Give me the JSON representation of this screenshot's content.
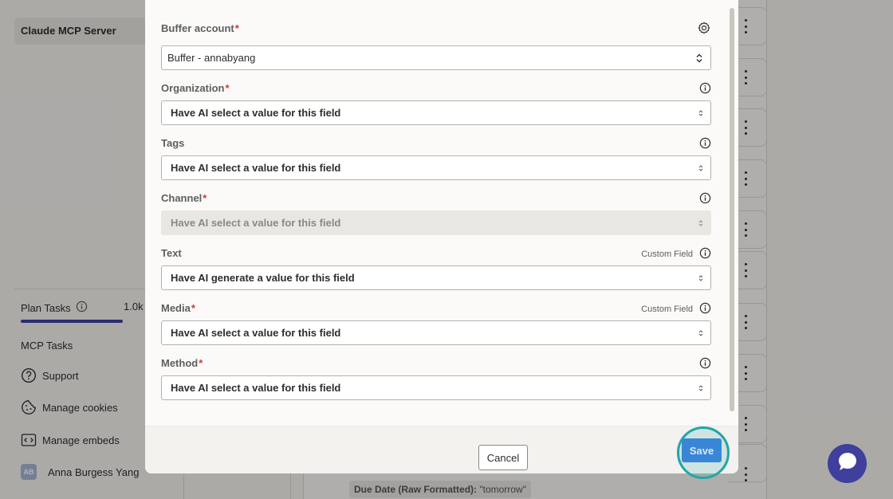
{
  "sidebar": {
    "active_item": "Claude MCP Server",
    "plan_tasks_label": "Plan Tasks",
    "plan_tasks_count": "1.0k",
    "plan_tasks_progress": 0.67,
    "section_heading": "MCP Tasks",
    "links": [
      {
        "label": "Support",
        "icon": "help-circle-icon"
      },
      {
        "label": "Manage cookies",
        "icon": "cookie-icon"
      },
      {
        "label": "Manage embeds",
        "icon": "embed-code-icon"
      }
    ],
    "user": {
      "initials": "AB",
      "name": "Anna Burgess Yang"
    }
  },
  "background": {
    "due_chip_label": "Due Date (Raw Formatted):",
    "due_chip_value": "\"tomorrow\""
  },
  "modal": {
    "account": {
      "label": "Buffer account",
      "value": "Buffer - annabyang"
    },
    "fields": [
      {
        "label": "Organization",
        "required": true,
        "value": "Have AI select a value for this field",
        "custom_field": "",
        "disabled": false
      },
      {
        "label": "Tags",
        "required": false,
        "value": "Have AI select a value for this field",
        "custom_field": "",
        "disabled": false
      },
      {
        "label": "Channel",
        "required": true,
        "value": "Have AI select a value for this field",
        "custom_field": "",
        "disabled": true
      },
      {
        "label": "Text",
        "required": false,
        "value": "Have AI generate a value for this field",
        "custom_field": "Custom Field",
        "disabled": false
      },
      {
        "label": "Media",
        "required": true,
        "value": "Have AI select a value for this field",
        "custom_field": "Custom Field",
        "disabled": false
      },
      {
        "label": "Method",
        "required": true,
        "value": "Have AI select a value for this field",
        "custom_field": "",
        "disabled": false
      }
    ],
    "required_mark": "*",
    "cancel_label": "Cancel",
    "save_label": "Save"
  },
  "colors": {
    "accent": "#403f9e",
    "save_button": "#3a86d6",
    "highlight_ring": "#20a6a6",
    "required": "#d13a3a"
  }
}
